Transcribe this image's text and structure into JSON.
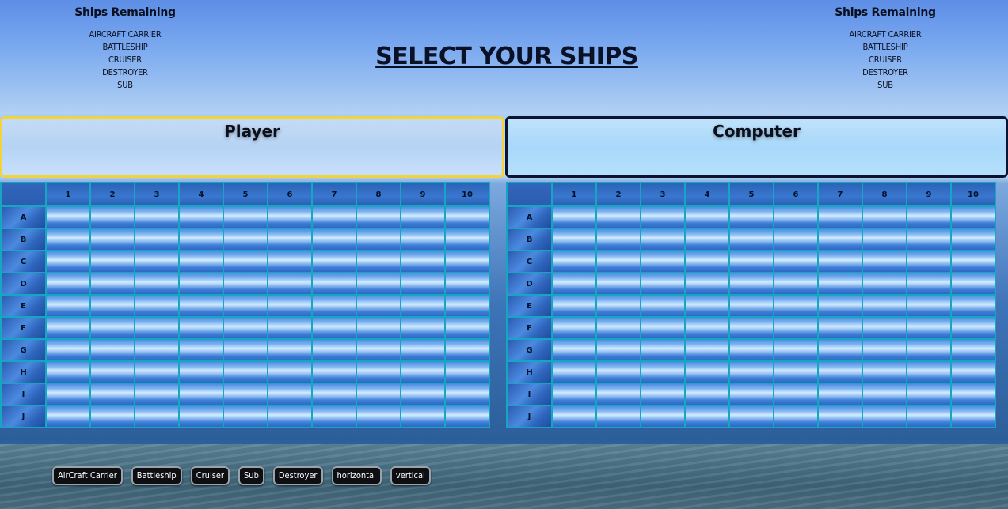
{
  "header": {
    "title": "SELECT YOUR SHIPS",
    "player_remaining": {
      "heading": "Ships Remaining",
      "ships": [
        "AIRCRAFT CARRIER",
        "BATTLESHIP",
        "CRUISER",
        "DESTROYER",
        "SUB"
      ]
    },
    "computer_remaining": {
      "heading": "Ships Remaining",
      "ships": [
        "AIRCRAFT CARRIER",
        "BATTLESHIP",
        "CRUISER",
        "DESTROYER",
        "SUB"
      ]
    }
  },
  "panels": {
    "player_label": "Player",
    "computer_label": "Computer"
  },
  "board": {
    "columns": [
      "1",
      "2",
      "3",
      "4",
      "5",
      "6",
      "7",
      "8",
      "9",
      "10"
    ],
    "rows": [
      "A",
      "B",
      "C",
      "D",
      "E",
      "F",
      "G",
      "H",
      "I",
      "J"
    ]
  },
  "controls": {
    "buttons": [
      "AirCraft Carrier",
      "Battleship",
      "Cruiser",
      "Sub",
      "Destroyer",
      "horizontal",
      "vertical"
    ]
  },
  "colors": {
    "player_panel_border": "#f2d33b",
    "computer_panel_border": "#0b1330",
    "grid_line": "#15a6c2"
  }
}
